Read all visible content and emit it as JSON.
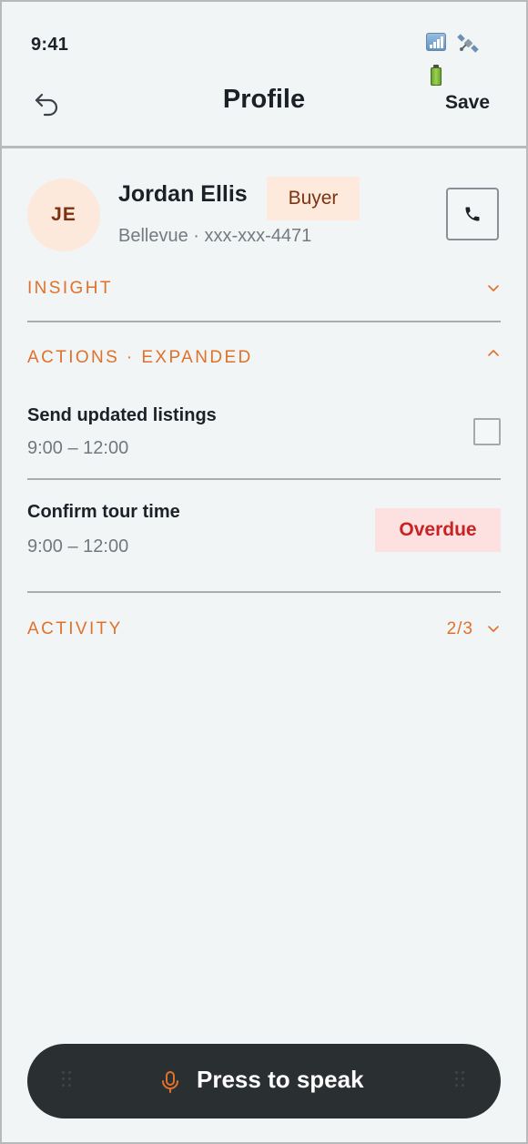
{
  "status_bar": {
    "time": "9:41",
    "icons": [
      "signal-icon",
      "satellite-icon",
      "battery-icon"
    ]
  },
  "header": {
    "title": "Profile",
    "back_icon": "undo-arrow-icon",
    "save_label": "Save"
  },
  "contact": {
    "initials": "JE",
    "name": "Jordan Ellis",
    "role": "Buyer",
    "subtitle": "Bellevue · xxx-xxx-4471",
    "call_icon": "phone-icon"
  },
  "sections": {
    "insight": {
      "label": "INSIGHT",
      "expanded": false
    },
    "actions": {
      "label": "ACTIONS · EXPANDED",
      "expanded": true
    },
    "activity": {
      "label": "ACTIVITY",
      "count": "2/3",
      "expanded": false
    }
  },
  "tasks": [
    {
      "title": "Send updated listings",
      "time": "9:00 – 12:00",
      "checked": false
    },
    {
      "title": "Confirm tour time",
      "time": "9:00 – 12:00",
      "status": "Overdue"
    }
  ],
  "voice": {
    "label": "Press to speak",
    "icon": "microphone-icon"
  },
  "colors": {
    "background": "#f1f5f6",
    "accent": "#e0712a",
    "avatar_bg": "#fde9db",
    "badge_bg": "#fdeadc",
    "overdue_bg": "#fde1e1",
    "overdue_text": "#c82323",
    "voice_bar": "#2a3032"
  }
}
